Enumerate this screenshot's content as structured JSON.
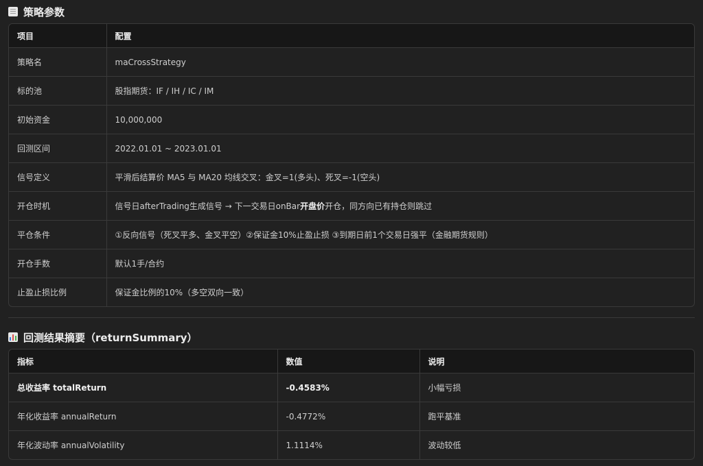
{
  "params_section": {
    "title": "策略参数",
    "icon": "document-icon",
    "headers": [
      "项目",
      "配置"
    ],
    "rows": [
      {
        "item": "策略名",
        "config": "maCrossStrategy"
      },
      {
        "item": "标的池",
        "config": "股指期货：IF / IH / IC / IM"
      },
      {
        "item": "初始资金",
        "config": "10,000,000"
      },
      {
        "item": "回测区间",
        "config": "2022.01.01 ~ 2023.01.01"
      },
      {
        "item": "信号定义",
        "config": "平滑后结算价 MA5 与 MA20 均线交叉：金叉=1(多头)、死叉=-1(空头)"
      },
      {
        "item": "开仓时机",
        "config_pre": "信号日afterTrading生成信号 → 下一交易日onBar",
        "config_bold": "开盘价",
        "config_post": "开仓，同方向已有持仓则跳过"
      },
      {
        "item": "平仓条件",
        "config": "①反向信号（死叉平多、金叉平空）②保证金10%止盈止损 ③到期日前1个交易日强平（金融期货规则）"
      },
      {
        "item": "开仓手数",
        "config": "默认1手/合约"
      },
      {
        "item": "止盈止损比例",
        "config": "保证金比例的10%（多空双向一致）"
      }
    ]
  },
  "summary_section": {
    "title": "回测结果摘要（returnSummary）",
    "icon": "bar-chart-icon",
    "headers": [
      "指标",
      "数值",
      "说明"
    ],
    "rows": [
      {
        "metric": "总收益率 totalReturn",
        "value": "-0.4583%",
        "note": "小幅亏损",
        "bold": true
      },
      {
        "metric": "年化收益率 annualReturn",
        "value": "-0.4772%",
        "note": "跑平基准",
        "bold": false
      },
      {
        "metric": "年化波动率 annualVolatility",
        "value": "1.1114%",
        "note": "波动较低",
        "bold": false
      }
    ]
  }
}
